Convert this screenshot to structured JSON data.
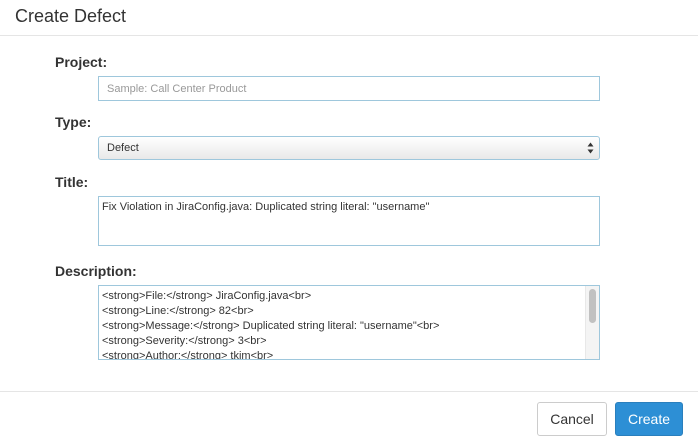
{
  "dialog": {
    "title": "Create Defect"
  },
  "form": {
    "project": {
      "label": "Project:",
      "placeholder": "Sample: Call Center Product"
    },
    "type": {
      "label": "Type:",
      "selected": "Defect"
    },
    "title_field": {
      "label": "Title:",
      "value": "Fix Violation in JiraConfig.java: Duplicated string literal: \"username\""
    },
    "description": {
      "label": "Description:",
      "lines": [
        "<strong>File:</strong> JiraConfig.java<br>",
        "<strong>Line:</strong> 82<br>",
        "<strong>Message:</strong> Duplicated string literal: \"username\"<br>",
        "<strong>Severity:</strong> 3<br>",
        "<strong>Author:</strong> tkim<br>"
      ]
    }
  },
  "footer": {
    "cancel_label": "Cancel",
    "create_label": "Create"
  }
}
